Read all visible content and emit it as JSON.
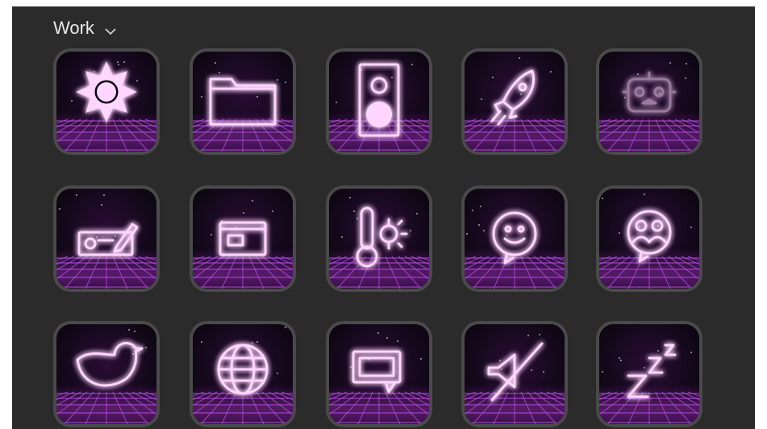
{
  "group": {
    "title": "Work",
    "dropdown_icon": "chevron-down-icon"
  },
  "icons": [
    {
      "name": "sun-icon",
      "glyph": "sun"
    },
    {
      "name": "folder-icon",
      "glyph": "folder"
    },
    {
      "name": "speaker-icon",
      "glyph": "speaker"
    },
    {
      "name": "rocket-icon",
      "glyph": "rocket"
    },
    {
      "name": "robot-icon",
      "glyph": "robot",
      "dim": true
    },
    {
      "name": "check-sign-icon",
      "glyph": "check"
    },
    {
      "name": "window-card-icon",
      "glyph": "window"
    },
    {
      "name": "thermometer-sun-icon",
      "glyph": "thermo"
    },
    {
      "name": "smiley-chat-icon",
      "glyph": "smiley"
    },
    {
      "name": "people-chat-icon",
      "glyph": "people"
    },
    {
      "name": "twitter-bird-icon",
      "glyph": "bird"
    },
    {
      "name": "globe-icon",
      "glyph": "globe"
    },
    {
      "name": "chat-bubble-icon",
      "glyph": "chat"
    },
    {
      "name": "mute-speaker-icon",
      "glyph": "mute"
    },
    {
      "name": "sleep-zzz-icon",
      "glyph": "zzz"
    }
  ],
  "colors": {
    "panel_bg": "#2b2b2b",
    "tile_frame": "#4a4a4a",
    "neon": "#ffd6ff",
    "glow": "#d23cff",
    "grid_line": "#b04ad8"
  }
}
